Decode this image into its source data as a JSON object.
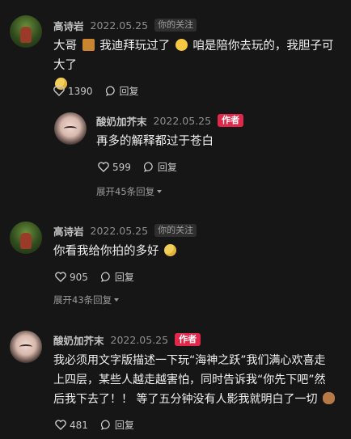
{
  "comments": [
    {
      "user": "高诗岩",
      "date": "2022.05.25",
      "badge": "你的关注",
      "text_a": "大哥 ",
      "text_b": " 我迪拜玩过了 ",
      "text_c": " 咱是陪你去玩的，我胆子可大了",
      "likes": "1390",
      "reply_label": "回复"
    },
    {
      "user": "酸奶加芥末",
      "date": "2022.05.25",
      "badge": "作者",
      "text": "再多的解释都过于苍白",
      "likes": "599",
      "reply_label": "回复",
      "expand_label": "展开45条回复"
    },
    {
      "user": "高诗岩",
      "date": "2022.05.25",
      "badge": "你的关注",
      "text": "你看我给你拍的多好 ",
      "likes": "905",
      "reply_label": "回复",
      "expand_label": "展开43条回复"
    },
    {
      "user": "酸奶加芥末",
      "date": "2022.05.25",
      "badge": "作者",
      "line1": "我必须用文字版描述一下玩“海神之跃”我们满心欢喜走",
      "line2": "上四层，某些人越走越害怕，同时告诉我“你先下吧”然",
      "line3": "后我下去了！！ 等了五分钟没有人影我就明白了一切 ",
      "likes": "481",
      "reply_label": "回复"
    }
  ],
  "colors": {
    "author_tag": "#e0294a",
    "background": "#161616"
  },
  "icons": [
    "heart-icon",
    "comment-bubble-icon",
    "caret-down-icon"
  ]
}
